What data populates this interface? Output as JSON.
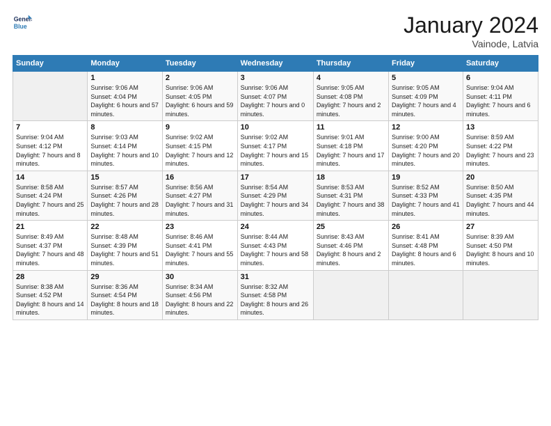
{
  "logo": {
    "line1": "General",
    "line2": "Blue"
  },
  "title": "January 2024",
  "location": "Vainode, Latvia",
  "days_header": [
    "Sunday",
    "Monday",
    "Tuesday",
    "Wednesday",
    "Thursday",
    "Friday",
    "Saturday"
  ],
  "weeks": [
    [
      {
        "day": "",
        "sunrise": "",
        "sunset": "",
        "daylight": ""
      },
      {
        "day": "1",
        "sunrise": "Sunrise: 9:06 AM",
        "sunset": "Sunset: 4:04 PM",
        "daylight": "Daylight: 6 hours and 57 minutes."
      },
      {
        "day": "2",
        "sunrise": "Sunrise: 9:06 AM",
        "sunset": "Sunset: 4:05 PM",
        "daylight": "Daylight: 6 hours and 59 minutes."
      },
      {
        "day": "3",
        "sunrise": "Sunrise: 9:06 AM",
        "sunset": "Sunset: 4:07 PM",
        "daylight": "Daylight: 7 hours and 0 minutes."
      },
      {
        "day": "4",
        "sunrise": "Sunrise: 9:05 AM",
        "sunset": "Sunset: 4:08 PM",
        "daylight": "Daylight: 7 hours and 2 minutes."
      },
      {
        "day": "5",
        "sunrise": "Sunrise: 9:05 AM",
        "sunset": "Sunset: 4:09 PM",
        "daylight": "Daylight: 7 hours and 4 minutes."
      },
      {
        "day": "6",
        "sunrise": "Sunrise: 9:04 AM",
        "sunset": "Sunset: 4:11 PM",
        "daylight": "Daylight: 7 hours and 6 minutes."
      }
    ],
    [
      {
        "day": "7",
        "sunrise": "Sunrise: 9:04 AM",
        "sunset": "Sunset: 4:12 PM",
        "daylight": "Daylight: 7 hours and 8 minutes."
      },
      {
        "day": "8",
        "sunrise": "Sunrise: 9:03 AM",
        "sunset": "Sunset: 4:14 PM",
        "daylight": "Daylight: 7 hours and 10 minutes."
      },
      {
        "day": "9",
        "sunrise": "Sunrise: 9:02 AM",
        "sunset": "Sunset: 4:15 PM",
        "daylight": "Daylight: 7 hours and 12 minutes."
      },
      {
        "day": "10",
        "sunrise": "Sunrise: 9:02 AM",
        "sunset": "Sunset: 4:17 PM",
        "daylight": "Daylight: 7 hours and 15 minutes."
      },
      {
        "day": "11",
        "sunrise": "Sunrise: 9:01 AM",
        "sunset": "Sunset: 4:18 PM",
        "daylight": "Daylight: 7 hours and 17 minutes."
      },
      {
        "day": "12",
        "sunrise": "Sunrise: 9:00 AM",
        "sunset": "Sunset: 4:20 PM",
        "daylight": "Daylight: 7 hours and 20 minutes."
      },
      {
        "day": "13",
        "sunrise": "Sunrise: 8:59 AM",
        "sunset": "Sunset: 4:22 PM",
        "daylight": "Daylight: 7 hours and 23 minutes."
      }
    ],
    [
      {
        "day": "14",
        "sunrise": "Sunrise: 8:58 AM",
        "sunset": "Sunset: 4:24 PM",
        "daylight": "Daylight: 7 hours and 25 minutes."
      },
      {
        "day": "15",
        "sunrise": "Sunrise: 8:57 AM",
        "sunset": "Sunset: 4:26 PM",
        "daylight": "Daylight: 7 hours and 28 minutes."
      },
      {
        "day": "16",
        "sunrise": "Sunrise: 8:56 AM",
        "sunset": "Sunset: 4:27 PM",
        "daylight": "Daylight: 7 hours and 31 minutes."
      },
      {
        "day": "17",
        "sunrise": "Sunrise: 8:54 AM",
        "sunset": "Sunset: 4:29 PM",
        "daylight": "Daylight: 7 hours and 34 minutes."
      },
      {
        "day": "18",
        "sunrise": "Sunrise: 8:53 AM",
        "sunset": "Sunset: 4:31 PM",
        "daylight": "Daylight: 7 hours and 38 minutes."
      },
      {
        "day": "19",
        "sunrise": "Sunrise: 8:52 AM",
        "sunset": "Sunset: 4:33 PM",
        "daylight": "Daylight: 7 hours and 41 minutes."
      },
      {
        "day": "20",
        "sunrise": "Sunrise: 8:50 AM",
        "sunset": "Sunset: 4:35 PM",
        "daylight": "Daylight: 7 hours and 44 minutes."
      }
    ],
    [
      {
        "day": "21",
        "sunrise": "Sunrise: 8:49 AM",
        "sunset": "Sunset: 4:37 PM",
        "daylight": "Daylight: 7 hours and 48 minutes."
      },
      {
        "day": "22",
        "sunrise": "Sunrise: 8:48 AM",
        "sunset": "Sunset: 4:39 PM",
        "daylight": "Daylight: 7 hours and 51 minutes."
      },
      {
        "day": "23",
        "sunrise": "Sunrise: 8:46 AM",
        "sunset": "Sunset: 4:41 PM",
        "daylight": "Daylight: 7 hours and 55 minutes."
      },
      {
        "day": "24",
        "sunrise": "Sunrise: 8:44 AM",
        "sunset": "Sunset: 4:43 PM",
        "daylight": "Daylight: 7 hours and 58 minutes."
      },
      {
        "day": "25",
        "sunrise": "Sunrise: 8:43 AM",
        "sunset": "Sunset: 4:46 PM",
        "daylight": "Daylight: 8 hours and 2 minutes."
      },
      {
        "day": "26",
        "sunrise": "Sunrise: 8:41 AM",
        "sunset": "Sunset: 4:48 PM",
        "daylight": "Daylight: 8 hours and 6 minutes."
      },
      {
        "day": "27",
        "sunrise": "Sunrise: 8:39 AM",
        "sunset": "Sunset: 4:50 PM",
        "daylight": "Daylight: 8 hours and 10 minutes."
      }
    ],
    [
      {
        "day": "28",
        "sunrise": "Sunrise: 8:38 AM",
        "sunset": "Sunset: 4:52 PM",
        "daylight": "Daylight: 8 hours and 14 minutes."
      },
      {
        "day": "29",
        "sunrise": "Sunrise: 8:36 AM",
        "sunset": "Sunset: 4:54 PM",
        "daylight": "Daylight: 8 hours and 18 minutes."
      },
      {
        "day": "30",
        "sunrise": "Sunrise: 8:34 AM",
        "sunset": "Sunset: 4:56 PM",
        "daylight": "Daylight: 8 hours and 22 minutes."
      },
      {
        "day": "31",
        "sunrise": "Sunrise: 8:32 AM",
        "sunset": "Sunset: 4:58 PM",
        "daylight": "Daylight: 8 hours and 26 minutes."
      },
      {
        "day": "",
        "sunrise": "",
        "sunset": "",
        "daylight": ""
      },
      {
        "day": "",
        "sunrise": "",
        "sunset": "",
        "daylight": ""
      },
      {
        "day": "",
        "sunrise": "",
        "sunset": "",
        "daylight": ""
      }
    ]
  ]
}
